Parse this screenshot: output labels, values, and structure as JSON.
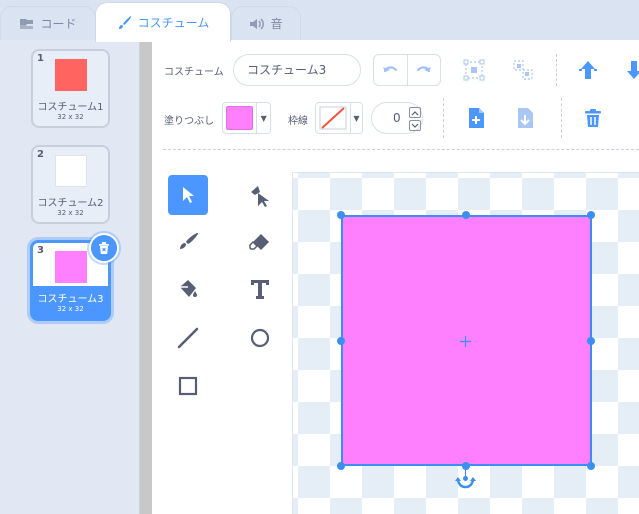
{
  "tabs": [
    {
      "label": "コード",
      "icon": "code-blocks-icon"
    },
    {
      "label": "コスチューム",
      "icon": "paintbrush-icon"
    },
    {
      "label": "音",
      "icon": "speaker-icon"
    }
  ],
  "costumes": [
    {
      "number": "1",
      "name": "コスチューム1",
      "size": "32 x 32",
      "color": "#ff6461"
    },
    {
      "number": "2",
      "name": "コスチューム2",
      "size": "32 x 32",
      "color": "#ffffff"
    },
    {
      "number": "3",
      "name": "コスチューム3",
      "size": "32 x 32",
      "color": "#ff80ff",
      "selected": true
    }
  ],
  "editor": {
    "costume_label": "コスチューム",
    "costume_name": "コスチューム3",
    "fill_label": "塗りつぶし",
    "fill_color": "#ff80ff",
    "outline_label": "枠線",
    "outline_width": "0"
  },
  "tools": [
    "select-tool",
    "reshape-tool",
    "brush-tool",
    "eraser-tool",
    "fill-tool",
    "text-tool",
    "line-tool",
    "circle-tool",
    "rectangle-tool"
  ],
  "colors": {
    "accent": "#4c97ff",
    "selection": "#3b8ff0"
  }
}
